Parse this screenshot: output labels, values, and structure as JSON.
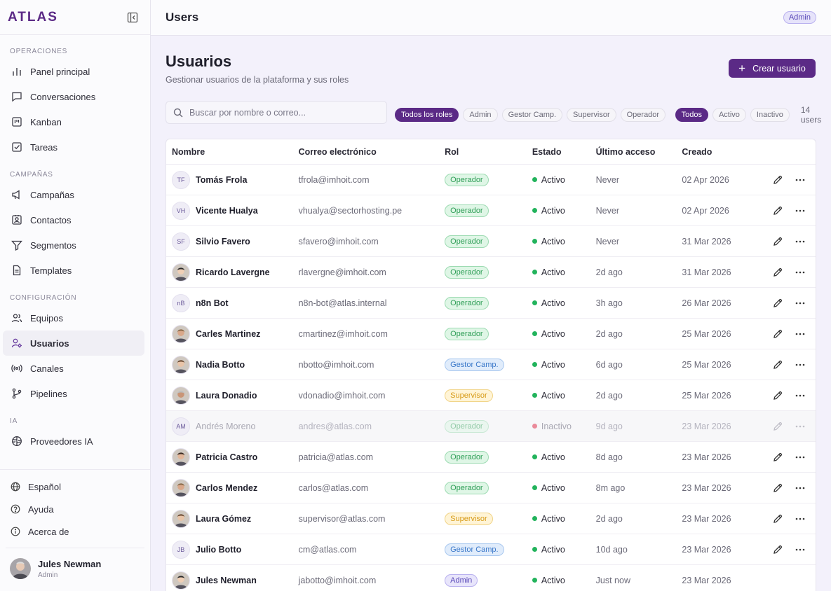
{
  "brand": "ATLAS",
  "sidebar": {
    "sections": [
      {
        "label": "OPERACIONES",
        "items": [
          {
            "label": "Panel principal",
            "icon": "bar-chart-icon"
          },
          {
            "label": "Conversaciones",
            "icon": "chat-icon"
          },
          {
            "label": "Kanban",
            "icon": "kanban-icon"
          },
          {
            "label": "Tareas",
            "icon": "checkbox-icon"
          }
        ]
      },
      {
        "label": "CAMPAÑAS",
        "items": [
          {
            "label": "Campañas",
            "icon": "megaphone-icon"
          },
          {
            "label": "Contactos",
            "icon": "contact-card-icon"
          },
          {
            "label": "Segmentos",
            "icon": "filter-icon"
          },
          {
            "label": "Templates",
            "icon": "document-icon"
          }
        ]
      },
      {
        "label": "CONFIGURACIÓN",
        "items": [
          {
            "label": "Equipos",
            "icon": "team-icon"
          },
          {
            "label": "Usuarios",
            "icon": "user-cog-icon",
            "active": true
          },
          {
            "label": "Canales",
            "icon": "broadcast-icon"
          },
          {
            "label": "Pipelines",
            "icon": "branch-icon"
          }
        ]
      },
      {
        "label": "IA",
        "items": [
          {
            "label": "Proveedores IA",
            "icon": "brain-icon"
          }
        ]
      }
    ],
    "bottom": [
      {
        "label": "Español",
        "icon": "globe-icon"
      },
      {
        "label": "Ayuda",
        "icon": "help-circle-icon"
      },
      {
        "label": "Acerca de",
        "icon": "info-circle-icon"
      }
    ],
    "current_user": {
      "name": "Jules Newman",
      "role": "Admin"
    }
  },
  "topbar": {
    "title": "Users",
    "badge": "Admin"
  },
  "page": {
    "title": "Usuarios",
    "subtitle": "Gestionar usuarios de la plataforma y sus roles",
    "create_button": "Crear usuario",
    "search_placeholder": "Buscar por nombre o correo...",
    "role_filters": [
      "Todos los roles",
      "Admin",
      "Gestor Camp.",
      "Supervisor",
      "Operador"
    ],
    "status_filters": [
      "Todos",
      "Activo",
      "Inactivo"
    ],
    "active_role_filter": "Todos los roles",
    "active_status_filter": "Todos",
    "user_count": "14 users"
  },
  "table": {
    "headers": [
      "Nombre",
      "Correo electrónico",
      "Rol",
      "Estado",
      "Último acceso",
      "Creado"
    ],
    "rows": [
      {
        "initials": "TF",
        "photo": false,
        "name": "Tomás Frola",
        "email": "tfrola@imhoit.com",
        "role": "Operador",
        "status": "Activo",
        "last": "Never",
        "created": "02 Apr 2026",
        "editable": true
      },
      {
        "initials": "VH",
        "photo": false,
        "name": "Vicente Hualya",
        "email": "vhualya@sectorhosting.pe",
        "role": "Operador",
        "status": "Activo",
        "last": "Never",
        "created": "02 Apr 2026",
        "editable": true
      },
      {
        "initials": "SF",
        "photo": false,
        "name": "Silvio Favero",
        "email": "sfavero@imhoit.com",
        "role": "Operador",
        "status": "Activo",
        "last": "Never",
        "created": "31 Mar 2026",
        "editable": true
      },
      {
        "initials": "",
        "photo": true,
        "name": "Ricardo Lavergne",
        "email": "rlavergne@imhoit.com",
        "role": "Operador",
        "status": "Activo",
        "last": "2d ago",
        "created": "31 Mar 2026",
        "editable": true
      },
      {
        "initials": "nB",
        "photo": false,
        "name": "n8n Bot",
        "email": "n8n-bot@atlas.internal",
        "role": "Operador",
        "status": "Activo",
        "last": "3h ago",
        "created": "26 Mar 2026",
        "editable": true
      },
      {
        "initials": "",
        "photo": true,
        "name": "Carles Martinez",
        "email": "cmartinez@imhoit.com",
        "role": "Operador",
        "status": "Activo",
        "last": "2d ago",
        "created": "25 Mar 2026",
        "editable": true
      },
      {
        "initials": "",
        "photo": true,
        "name": "Nadia Botto",
        "email": "nbotto@imhoit.com",
        "role": "Gestor Camp.",
        "status": "Activo",
        "last": "6d ago",
        "created": "25 Mar 2026",
        "editable": true
      },
      {
        "initials": "",
        "photo": true,
        "name": "Laura Donadio",
        "email": "vdonadio@imhoit.com",
        "role": "Supervisor",
        "status": "Activo",
        "last": "2d ago",
        "created": "25 Mar 2026",
        "editable": true
      },
      {
        "initials": "AM",
        "photo": false,
        "name": "Andrés Moreno",
        "email": "andres@atlas.com",
        "role": "Operador",
        "status": "Inactivo",
        "last": "9d ago",
        "created": "23 Mar 2026",
        "editable": true
      },
      {
        "initials": "",
        "photo": true,
        "name": "Patricia Castro",
        "email": "patricia@atlas.com",
        "role": "Operador",
        "status": "Activo",
        "last": "8d ago",
        "created": "23 Mar 2026",
        "editable": true
      },
      {
        "initials": "",
        "photo": true,
        "name": "Carlos Mendez",
        "email": "carlos@atlas.com",
        "role": "Operador",
        "status": "Activo",
        "last": "8m ago",
        "created": "23 Mar 2026",
        "editable": true
      },
      {
        "initials": "",
        "photo": true,
        "name": "Laura Gómez",
        "email": "supervisor@atlas.com",
        "role": "Supervisor",
        "status": "Activo",
        "last": "2d ago",
        "created": "23 Mar 2026",
        "editable": true
      },
      {
        "initials": "JB",
        "photo": false,
        "name": "Julio Botto",
        "email": "cm@atlas.com",
        "role": "Gestor Camp.",
        "status": "Activo",
        "last": "10d ago",
        "created": "23 Mar 2026",
        "editable": true
      },
      {
        "initials": "",
        "photo": true,
        "name": "Jules Newman",
        "email": "jabotto@imhoit.com",
        "role": "Admin",
        "status": "Activo",
        "last": "Just now",
        "created": "23 Mar 2026",
        "editable": false
      }
    ]
  },
  "colors": {
    "brand": "#5b2a86",
    "active_dot": "#22b35c",
    "inactive_dot": "#ea8a9a"
  }
}
